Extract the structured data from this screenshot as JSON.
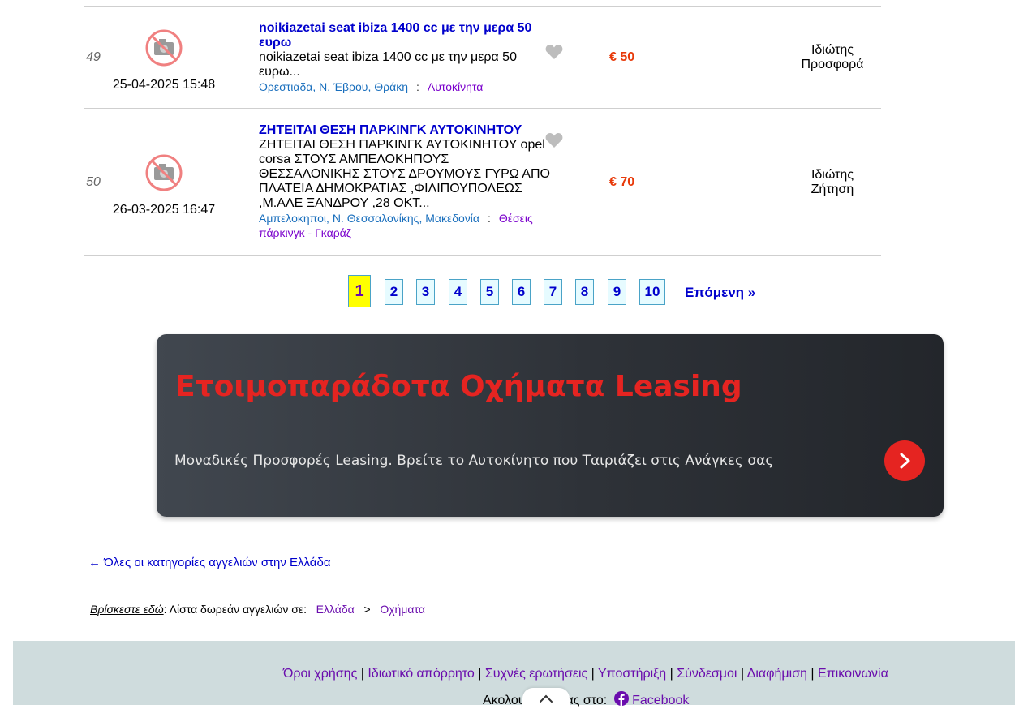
{
  "listings": [
    {
      "number": "49",
      "date": "25-04-2025 15:48",
      "title_line1": "noikiazetai seat ibiza 1400 cc με την μερα 50",
      "title_line2": "ευρω",
      "description_line1": "noikiazetai seat ibiza 1400 cc με την μερα 50",
      "description_line2": "ευρω...",
      "location": [
        "Ορεστιαδα",
        "Ν. Έβρου",
        "Θράκη"
      ],
      "separator": ":",
      "category": "Αυτοκίνητα",
      "price": "€ 50",
      "type_line1": "Ιδιώτης",
      "type_line2": "Προσφορά"
    },
    {
      "number": "50",
      "date": "26-03-2025 16:47",
      "title_line1": "ΖΗΤΕΙΤΑΙ ΘΕΣΗ ΠΑΡΚΙΝΓΚ ΑΥΤΟΚΙΝΗΤΟΥ",
      "description_lines": [
        "ΖΗΤΕΙΤΑΙ ΘΕΣΗ ΠΑΡΚΙΝΓΚ ΑΥΤΟΚΙΝΗΤΟΥ opel",
        "corsa ΣΤΟΥΣ ΑΜΠΕΛΟΚΗΠΟΥΣ",
        "ΘΕΣΣΑΛΟΝΙΚΗΣ ΣΤΟΥΣ ΔΡΟΥΜΟΥΣ ΓΥΡΩ ΑΠΟ",
        "ΠΛΑΤΕΙΑ ΔΗΜΟΚΡΑΤΙΑΣ ,ΦΙΛΙΠΟΥΠΟΛΕΩΣ",
        ",Μ.ΑΛΕ ΞΑΝΔΡΟΥ ,28 ΟΚΤ..."
      ],
      "location": [
        "Αμπελοκηποι",
        "Ν. Θεσσαλονίκης",
        "Μακεδονία"
      ],
      "separator": ":",
      "category_line1": "Θέσεις",
      "category_line2": "πάρκινγκ - Γκαράζ",
      "price": "€ 70",
      "type_line1": "Ιδιώτης",
      "type_line2": "Ζήτηση"
    }
  ],
  "pagination": {
    "pages": [
      "1",
      "2",
      "3",
      "4",
      "5",
      "6",
      "7",
      "8",
      "9",
      "10"
    ],
    "current": "1",
    "next_label": "Επόμενη »"
  },
  "banner": {
    "title": "Ετοιμοπαράδοτα Οχήματα Leasing",
    "subtitle": "Μοναδικές Προσφορές Leasing. Βρείτε το Αυτοκίνητο που Ταιριάζει στις Ανάγκες σας",
    "button_icon": "chevron-right-icon"
  },
  "back_link": "← Όλες οι κατηγορίες αγγελιών στην Ελλάδα",
  "breadcrumb": {
    "you_are_here": "Βρίσκεστε εδώ",
    "list_label": ": Λίστα δωρεάν αγγελιών σε:",
    "items": [
      "Ελλάδα",
      "Οχήματα"
    ],
    "separator": ">"
  },
  "footer": {
    "links": [
      "Όροι χρήσης",
      "Ιδιωτικό απόρρητο",
      "Συχνές ερωτήσεις",
      "Υποστήριξη",
      "Σύνδεσμοι",
      "Διαφήμιση",
      "Επικοινωνία"
    ],
    "link_separator": "|",
    "follow_prefix": "Ακολου",
    "follow_suffix": "ας στο:",
    "facebook": "Facebook"
  },
  "colors": {
    "title_blue": "#0000cc",
    "price_red": "#e83a0a",
    "banner_red": "#e52421",
    "current_page_bg": "#ffff00",
    "footer_bg": "#cfdcdd"
  }
}
